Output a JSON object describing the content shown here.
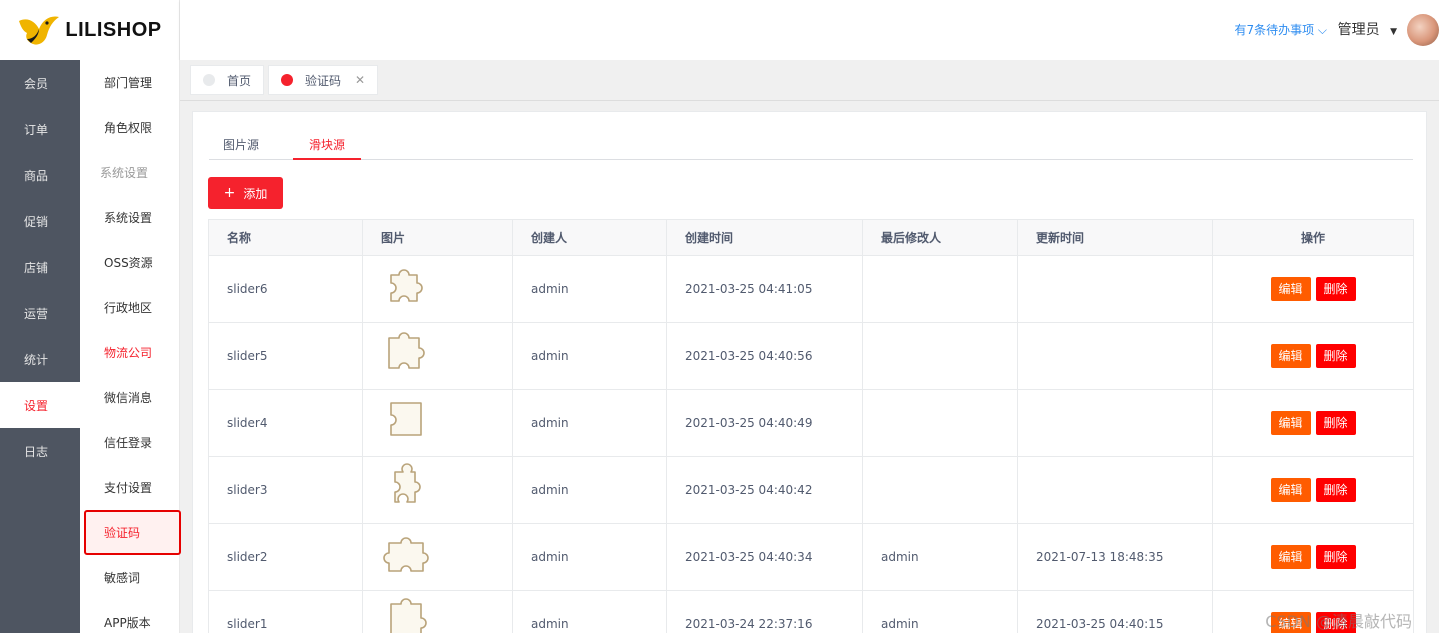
{
  "brand": {
    "name": "LILISHOP"
  },
  "header": {
    "todo_text": "有7条待办事项 ⌵",
    "user_name": "管理员"
  },
  "primary_nav": [
    {
      "label": "会员"
    },
    {
      "label": "订单"
    },
    {
      "label": "商品"
    },
    {
      "label": "促销"
    },
    {
      "label": "店铺"
    },
    {
      "label": "运营"
    },
    {
      "label": "统计"
    },
    {
      "label": "设置",
      "active": true
    },
    {
      "label": "日志"
    }
  ],
  "secondary_nav": [
    {
      "label": "部门管理"
    },
    {
      "label": "角色权限"
    },
    {
      "label": "系统设置",
      "group": true
    },
    {
      "label": "系统设置"
    },
    {
      "label": "OSS资源"
    },
    {
      "label": "行政地区"
    },
    {
      "label": "物流公司",
      "red": true
    },
    {
      "label": "微信消息"
    },
    {
      "label": "信任登录"
    },
    {
      "label": "支付设置"
    },
    {
      "label": "验证码",
      "selected": true
    },
    {
      "label": "敏感词"
    },
    {
      "label": "APP版本"
    }
  ],
  "tags": [
    {
      "label": "首页",
      "dot": "#e8eaec"
    },
    {
      "label": "验证码",
      "dot": "#f5222d",
      "closable": true
    }
  ],
  "tabs": [
    {
      "label": "图片源"
    },
    {
      "label": "滑块源",
      "active": true
    }
  ],
  "toolbar": {
    "add_label": "添加"
  },
  "table": {
    "columns": [
      "名称",
      "图片",
      "创建人",
      "创建时间",
      "最后修改人",
      "更新时间",
      "操作"
    ],
    "edit_label": "编辑",
    "delete_label": "删除",
    "rows": [
      {
        "name": "slider6",
        "creator": "admin",
        "created": "2021-03-25 04:41:05",
        "modifier": "",
        "updated": ""
      },
      {
        "name": "slider5",
        "creator": "admin",
        "created": "2021-03-25 04:40:56",
        "modifier": "",
        "updated": ""
      },
      {
        "name": "slider4",
        "creator": "admin",
        "created": "2021-03-25 04:40:49",
        "modifier": "",
        "updated": ""
      },
      {
        "name": "slider3",
        "creator": "admin",
        "created": "2021-03-25 04:40:42",
        "modifier": "",
        "updated": ""
      },
      {
        "name": "slider2",
        "creator": "admin",
        "created": "2021-03-25 04:40:34",
        "modifier": "admin",
        "updated": "2021-07-13 18:48:35"
      },
      {
        "name": "slider1",
        "creator": "admin",
        "created": "2021-03-24 22:37:16",
        "modifier": "admin",
        "updated": "2021-03-25 04:40:15"
      }
    ]
  },
  "watermark": "CSDN @清晨敲代码",
  "colors": {
    "accent": "#f5222d",
    "edit": "#ff5c00",
    "delete": "#ff0000",
    "nav_bg": "#4e5561"
  }
}
